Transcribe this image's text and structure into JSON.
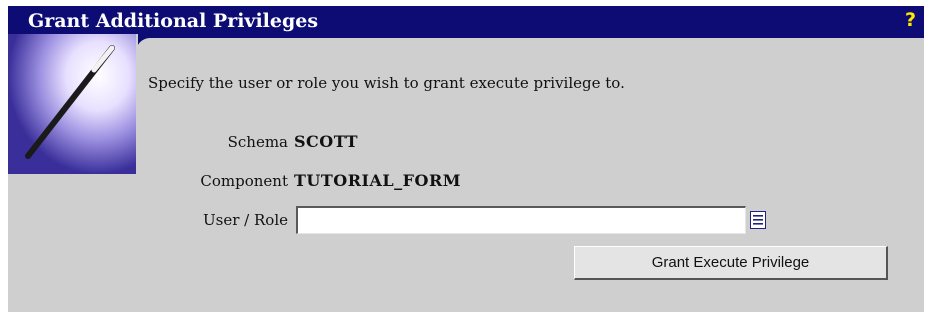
{
  "header": {
    "title": "Grant Additional Privileges",
    "help_label": "?"
  },
  "form": {
    "intro": "Specify the user or role you wish to grant execute privilege to.",
    "schema_label": "Schema",
    "schema_value": "SCOTT",
    "component_label": "Component",
    "component_value": "TUTORIAL_FORM",
    "user_role_label": "User / Role",
    "user_role_value": "",
    "lov_icon": "list-of-values-icon",
    "submit_label": "Grant Execute Privilege"
  },
  "colors": {
    "title_bar": "#0c0c74",
    "panel_bg": "#cfcfcf",
    "help_icon": "#ffe800"
  },
  "icons": {
    "wand": "magic-wand-icon",
    "help": "help-icon"
  }
}
